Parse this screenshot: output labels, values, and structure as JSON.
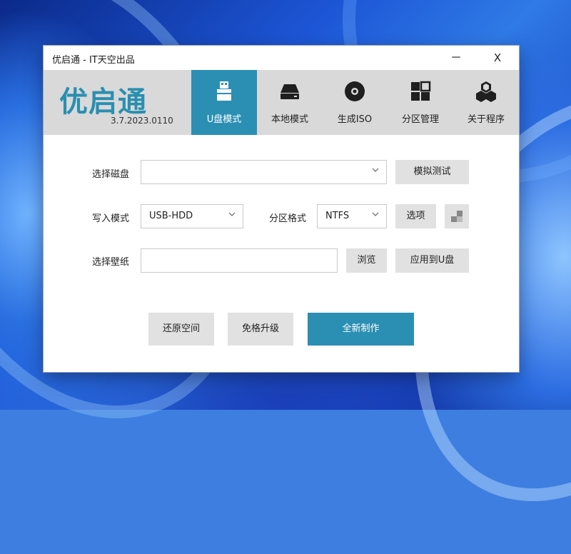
{
  "window": {
    "title": "优启通 - IT天空出品",
    "minimize_glyph": "－",
    "close_glyph": "X"
  },
  "header": {
    "logo_text": "优启通",
    "version": "3.7.2023.0110",
    "accent_color": "#2b8fb3"
  },
  "tabs": [
    {
      "label": "U盘模式",
      "icon": "usb-drive-icon",
      "active": true
    },
    {
      "label": "本地模式",
      "icon": "hard-disk-icon",
      "active": false
    },
    {
      "label": "生成ISO",
      "icon": "disc-icon",
      "active": false
    },
    {
      "label": "分区管理",
      "icon": "partition-grid-icon",
      "active": false
    },
    {
      "label": "关于程序",
      "icon": "cubes-icon",
      "active": false
    }
  ],
  "form": {
    "disk_label": "选择磁盘",
    "disk_value": "",
    "simulate_button": "模拟测试",
    "write_mode_label": "写入模式",
    "write_mode_value": "USB-HDD",
    "partition_format_label": "分区格式",
    "partition_format_value": "NTFS",
    "options_button": "选项",
    "wallpaper_label": "选择壁纸",
    "wallpaper_value": "",
    "browse_button": "浏览",
    "apply_to_usb_button": "应用到U盘"
  },
  "actions": {
    "restore_space": "还原空间",
    "format_free_upgrade": "免格升级",
    "new_build": "全新制作"
  }
}
